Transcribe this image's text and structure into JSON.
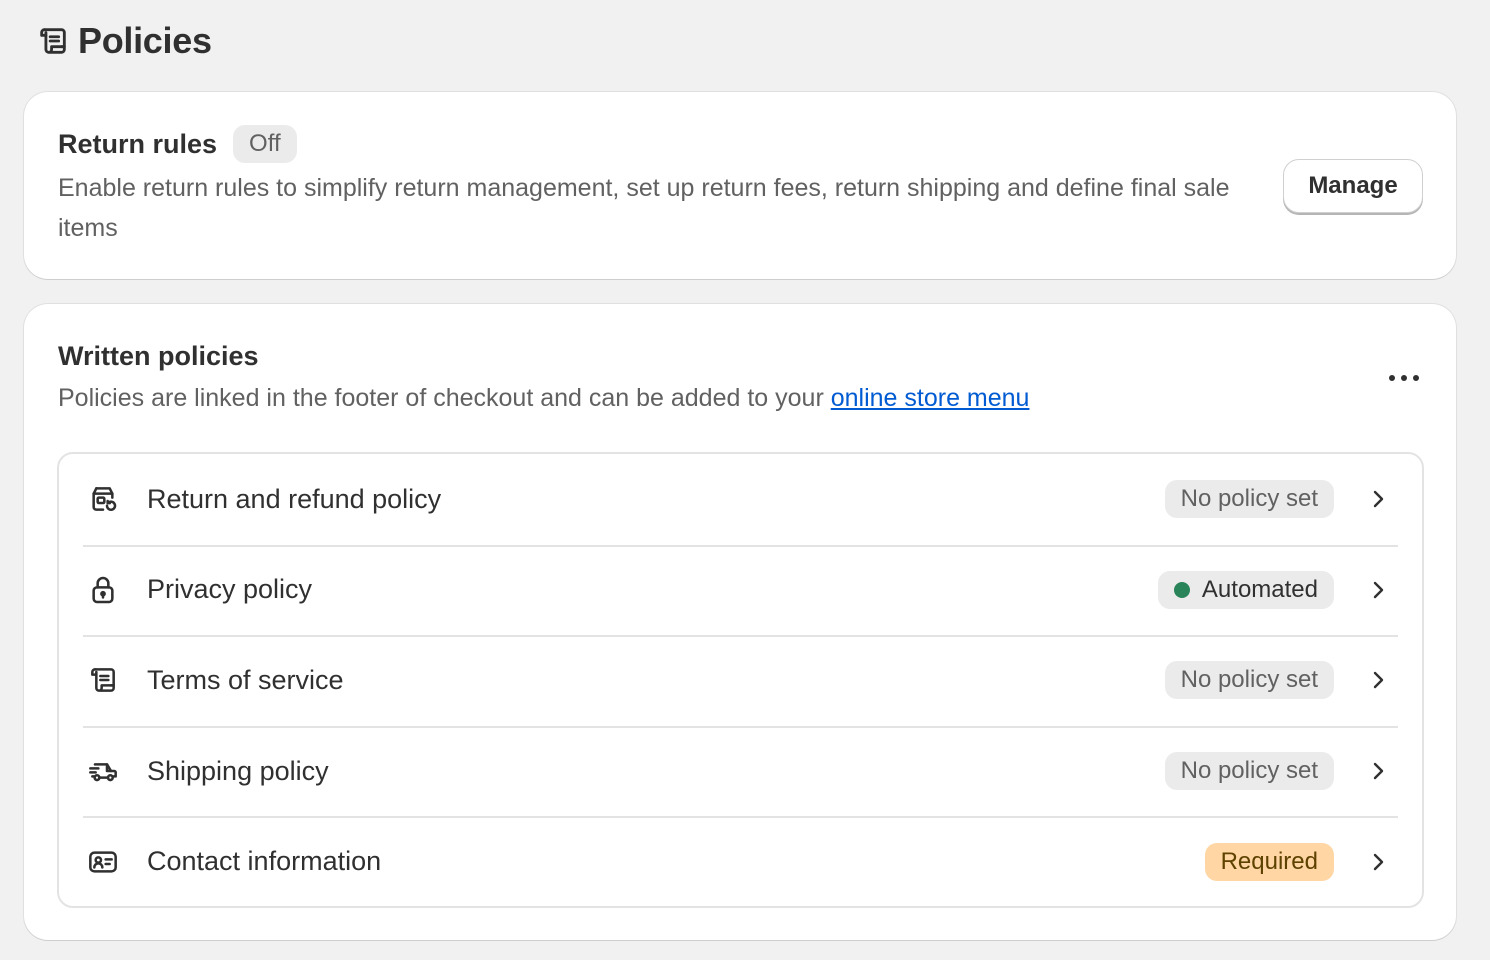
{
  "page": {
    "title": "Policies",
    "icon": "scroll-icon"
  },
  "return_rules": {
    "title": "Return rules",
    "status": "Off",
    "description": "Enable return rules to simplify return management, set up return fees, return shipping and define final sale items",
    "manage_label": "Manage"
  },
  "written_policies": {
    "title": "Written policies",
    "description_prefix": "Policies are linked in the footer of checkout and can be added to your ",
    "link_text": "online store menu",
    "more_icon": "ellipsis-icon",
    "items": [
      {
        "label": "Return and refund policy",
        "status": "No policy set",
        "status_type": "info",
        "icon": "return-box-icon"
      },
      {
        "label": "Privacy policy",
        "status": "Automated",
        "status_type": "success",
        "icon": "lock-icon"
      },
      {
        "label": "Terms of service",
        "status": "No policy set",
        "status_type": "info",
        "icon": "scroll-icon"
      },
      {
        "label": "Shipping policy",
        "status": "No policy set",
        "status_type": "info",
        "icon": "delivery-truck-icon"
      },
      {
        "label": "Contact information",
        "status": "Required",
        "status_type": "attention",
        "icon": "contact-card-icon"
      }
    ]
  },
  "colors": {
    "background": "#f1f1f1",
    "card": "#ffffff",
    "text": "#303030",
    "subdued_text": "#616161",
    "link": "#005bd3",
    "success_dot": "#29845a",
    "attention_badge": "#ffd6a4"
  }
}
